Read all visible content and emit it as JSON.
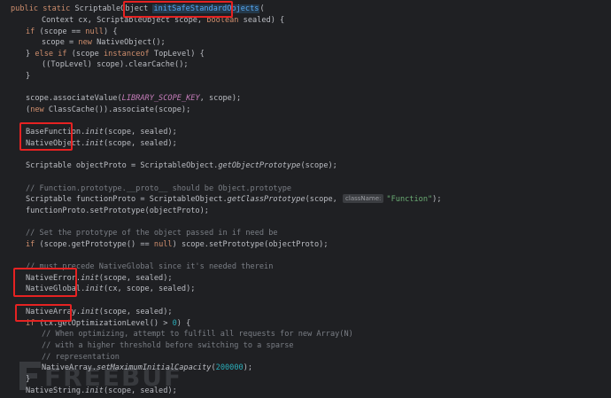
{
  "editor": {
    "theme_colors": {
      "background": "#1f2023",
      "text": "#bcbec4",
      "keyword": "#cf8e6d",
      "method_declaration": "#56a8f5",
      "constant": "#c77dbb",
      "comment": "#7a7e85",
      "string": "#6aab73",
      "number": "#2aacb8",
      "highlight_box": "#e52222"
    },
    "lines": [
      {
        "parts": [
          "public",
          "static",
          "ScriptableObject",
          "initSafeStandardObjects",
          "("
        ]
      },
      {
        "parts": [
          "Context cx, ScriptableObject scope, ",
          "boolean",
          " sealed) {"
        ]
      },
      {
        "parts": [
          "if",
          " (scope == ",
          "null",
          ") {"
        ]
      },
      {
        "parts": [
          "scope = ",
          "new",
          " NativeObject();"
        ]
      },
      {
        "parts": [
          "} ",
          "else if",
          " (scope ",
          "instanceof",
          " TopLevel) {"
        ]
      },
      {
        "parts": [
          "((TopLevel) scope).clearCache();"
        ]
      },
      {
        "parts": [
          "}"
        ]
      },
      {
        "parts": [
          "scope.associateValue(",
          "LIBRARY_SCOPE_KEY",
          ", scope);"
        ]
      },
      {
        "parts": [
          "(",
          "new",
          " ClassCache()).associate(scope);"
        ]
      },
      {
        "parts": [
          "BaseFunction.",
          "init",
          "(scope, sealed);"
        ]
      },
      {
        "parts": [
          "NativeObject.",
          "init",
          "(scope, sealed);"
        ]
      },
      {
        "parts": [
          "Scriptable objectProto = ScriptableObject.",
          "getObjectPrototype",
          "(scope);"
        ]
      },
      {
        "parts": [
          "// Function.prototype.__proto__ should be Object.prototype"
        ]
      },
      {
        "parts": [
          "Scriptable functionProto = ScriptableObject.",
          "getClassPrototype",
          "(scope, ",
          "className:",
          "\"Function\"",
          ");"
        ]
      },
      {
        "parts": [
          "functionProto.setPrototype(objectProto);"
        ]
      },
      {
        "parts": [
          "// Set the prototype of the object passed in if need be"
        ]
      },
      {
        "parts": [
          "if",
          " (scope.getPrototype() == ",
          "null",
          ") scope.setPrototype(objectProto);"
        ]
      },
      {
        "parts": [
          "// must precede NativeGlobal since it's needed therein"
        ]
      },
      {
        "parts": [
          "NativeError.",
          "init",
          "(scope, sealed);"
        ]
      },
      {
        "parts": [
          "NativeGlobal.",
          "init",
          "(cx, scope, sealed);"
        ]
      },
      {
        "parts": [
          "NativeArray.",
          "init",
          "(scope, sealed);"
        ]
      },
      {
        "parts": [
          "if",
          " (cx.getOptimizationLevel() > ",
          "0",
          ") {"
        ]
      },
      {
        "parts": [
          "// When optimizing, attempt to fulfill all requests for new Array(N)"
        ]
      },
      {
        "parts": [
          "// with a higher threshold before switching to a sparse"
        ]
      },
      {
        "parts": [
          "// representation"
        ]
      },
      {
        "parts": [
          "NativeArray.",
          "setMaximumInitialCapacity",
          "(",
          "200000",
          ");"
        ]
      },
      {
        "parts": [
          "}"
        ]
      },
      {
        "parts": [
          "NativeString.",
          "init",
          "(scope, sealed);"
        ]
      }
    ]
  },
  "watermark": {
    "text": "FREEBUF"
  }
}
